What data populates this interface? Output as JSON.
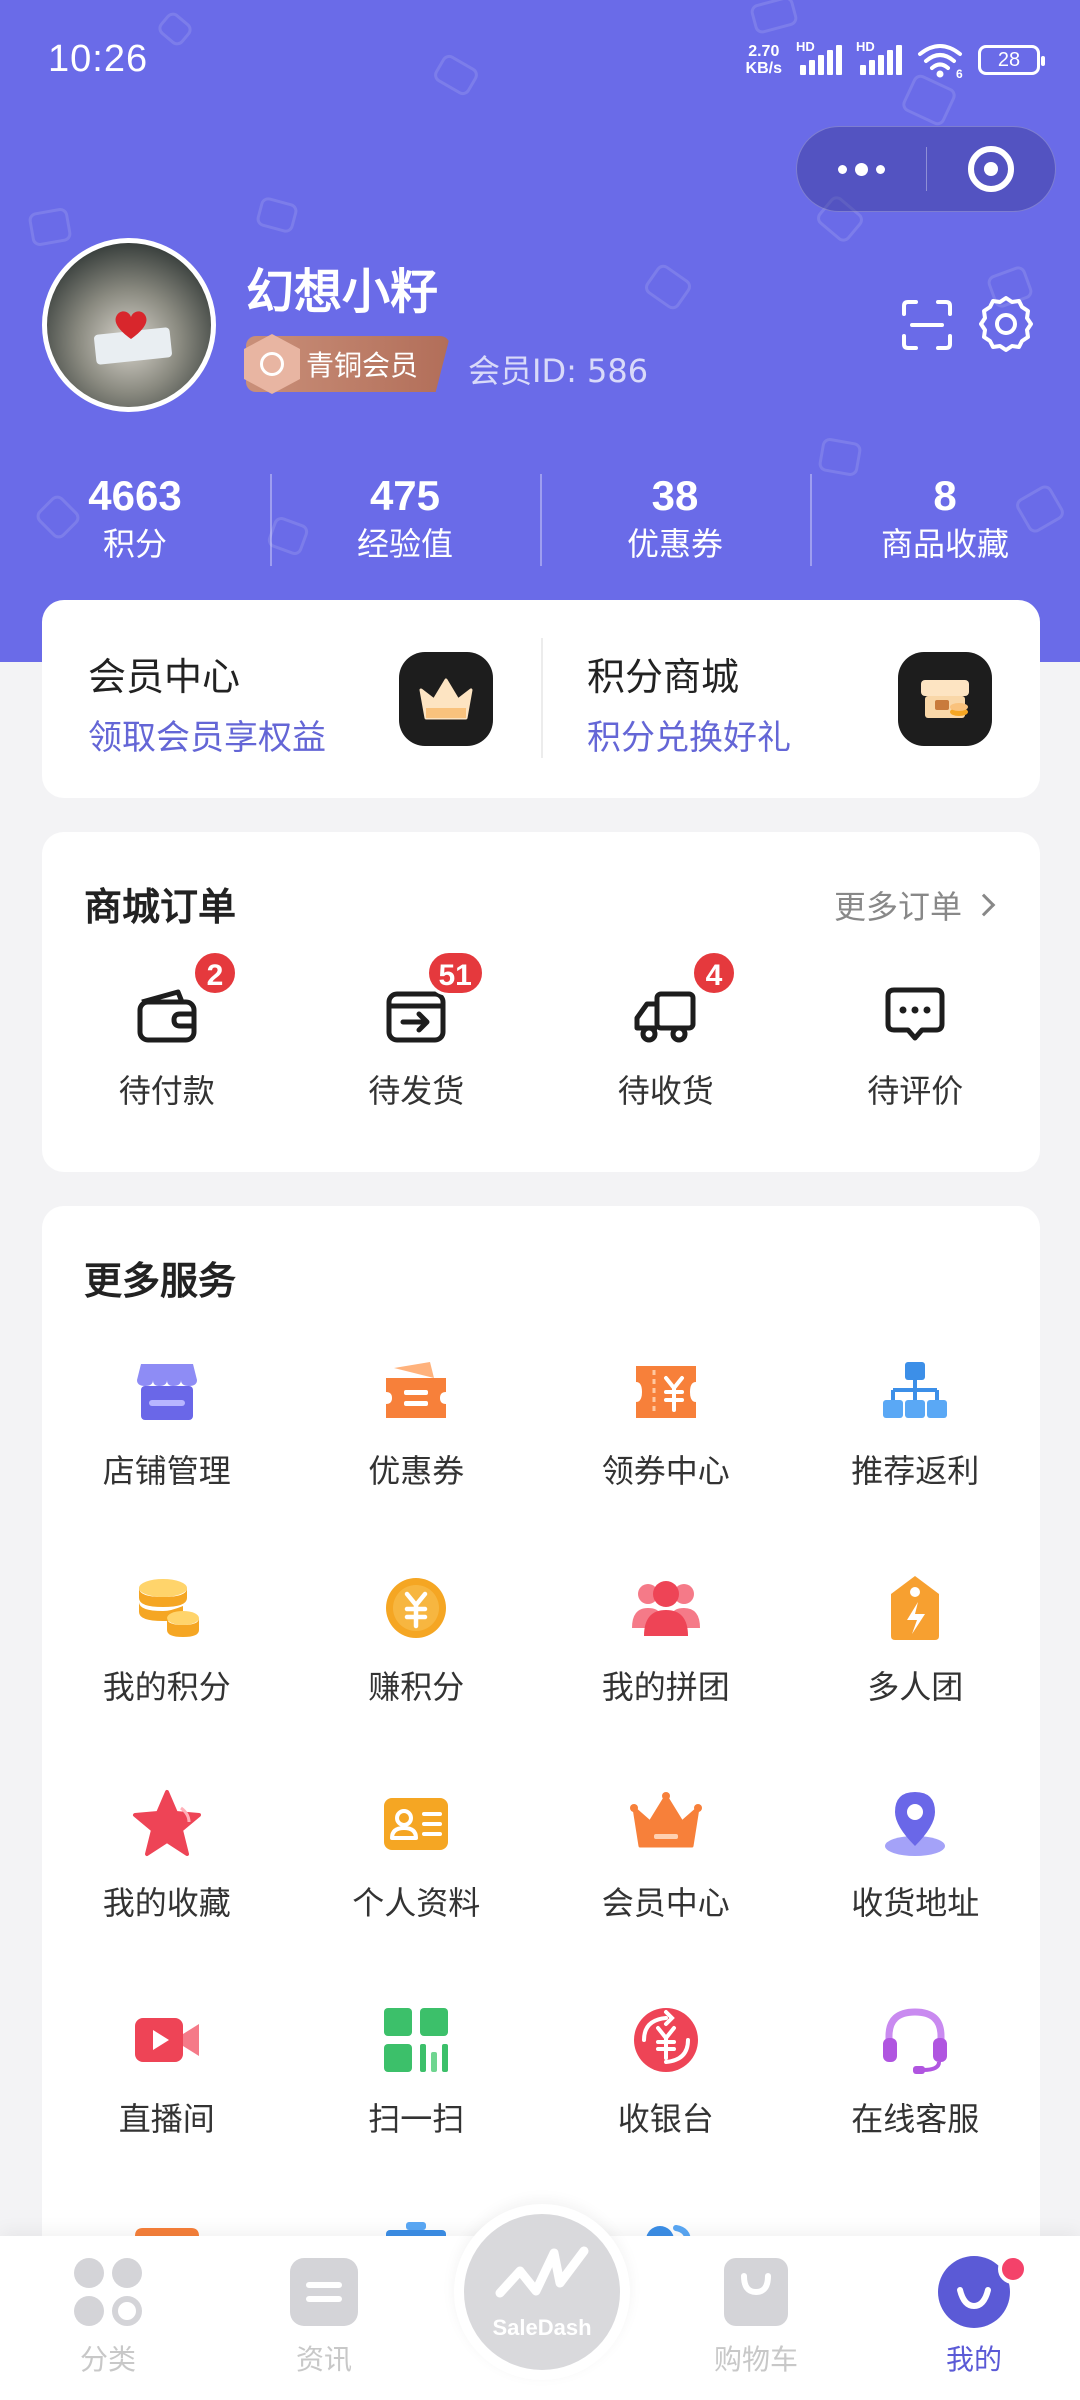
{
  "status_bar": {
    "time": "10:26",
    "net_speed_value": "2.70",
    "net_speed_unit": "KB/s",
    "signal1_label": "HD",
    "signal2_label": "HD",
    "wifi_label": "6",
    "battery": "28"
  },
  "profile": {
    "username": "幻想小籽",
    "level_badge": "青铜会员",
    "member_id": "会员ID: 586"
  },
  "stats": [
    {
      "value": "4663",
      "label": "积分"
    },
    {
      "value": "475",
      "label": "经验值"
    },
    {
      "value": "38",
      "label": "优惠券"
    },
    {
      "value": "8",
      "label": "商品收藏"
    }
  ],
  "member_card": {
    "left": {
      "title": "会员中心",
      "subtitle": "领取会员享权益",
      "icon": "crown-icon"
    },
    "right": {
      "title": "积分商城",
      "subtitle": "积分兑换好礼",
      "icon": "points-mall-icon"
    }
  },
  "orders": {
    "title": "商城订单",
    "more": "更多订单",
    "items": [
      {
        "label": "待付款",
        "count": "2",
        "icon": "wallet-icon"
      },
      {
        "label": "待发货",
        "count": "51",
        "icon": "package-out-icon"
      },
      {
        "label": "待收货",
        "count": "4",
        "icon": "truck-icon"
      },
      {
        "label": "待评价",
        "count": "",
        "icon": "comment-icon"
      }
    ]
  },
  "services": {
    "title": "更多服务",
    "items": [
      {
        "label": "店铺管理",
        "icon": "store-icon",
        "color": "#7a77f0"
      },
      {
        "label": "优惠券",
        "icon": "coupon-icon",
        "color": "#f7803a"
      },
      {
        "label": "领券中心",
        "icon": "yen-ticket-icon",
        "color": "#f7803a"
      },
      {
        "label": "推荐返利",
        "icon": "hierarchy-icon",
        "color": "#3c8fe8"
      },
      {
        "label": "我的积分",
        "icon": "coins-icon",
        "color": "#f5a623"
      },
      {
        "label": "赚积分",
        "icon": "yen-coin-icon",
        "color": "#f5a623"
      },
      {
        "label": "我的拼团",
        "icon": "group-icon",
        "color": "#ee4456"
      },
      {
        "label": "多人团",
        "icon": "tag-flash-icon",
        "color": "#f7a030"
      },
      {
        "label": "我的收藏",
        "icon": "star-icon",
        "color": "#ee4456"
      },
      {
        "label": "个人资料",
        "icon": "id-card-icon",
        "color": "#f5a623"
      },
      {
        "label": "会员中心",
        "icon": "crown-icon",
        "color": "#f7803a"
      },
      {
        "label": "收货地址",
        "icon": "location-icon",
        "color": "#7a77f0"
      },
      {
        "label": "直播间",
        "icon": "video-icon",
        "color": "#ee4456"
      },
      {
        "label": "扫一扫",
        "icon": "scan-grid-icon",
        "color": "#3cc06a"
      },
      {
        "label": "收银台",
        "icon": "yen-refresh-icon",
        "color": "#ee4456"
      },
      {
        "label": "在线客服",
        "icon": "headset-icon",
        "color": "#b055e0"
      },
      {
        "label": "",
        "icon": "chat-icon",
        "color": "#f7803a"
      },
      {
        "label": "",
        "icon": "trash-icon",
        "color": "#3c8fe8"
      },
      {
        "label": "",
        "icon": "users-icon",
        "color": "#3c8fe8"
      }
    ]
  },
  "tabbar": {
    "items": [
      {
        "label": "分类",
        "icon": "category-icon"
      },
      {
        "label": "资讯",
        "icon": "news-icon"
      },
      {
        "label": "SaleDash",
        "icon": "saledash-logo-icon"
      },
      {
        "label": "购物车",
        "icon": "cart-icon"
      },
      {
        "label": "我的",
        "icon": "profile-icon"
      }
    ]
  },
  "colors": {
    "brand": "#6a6be8",
    "accent_text": "#6466d6",
    "badge_red": "#e5393d"
  }
}
